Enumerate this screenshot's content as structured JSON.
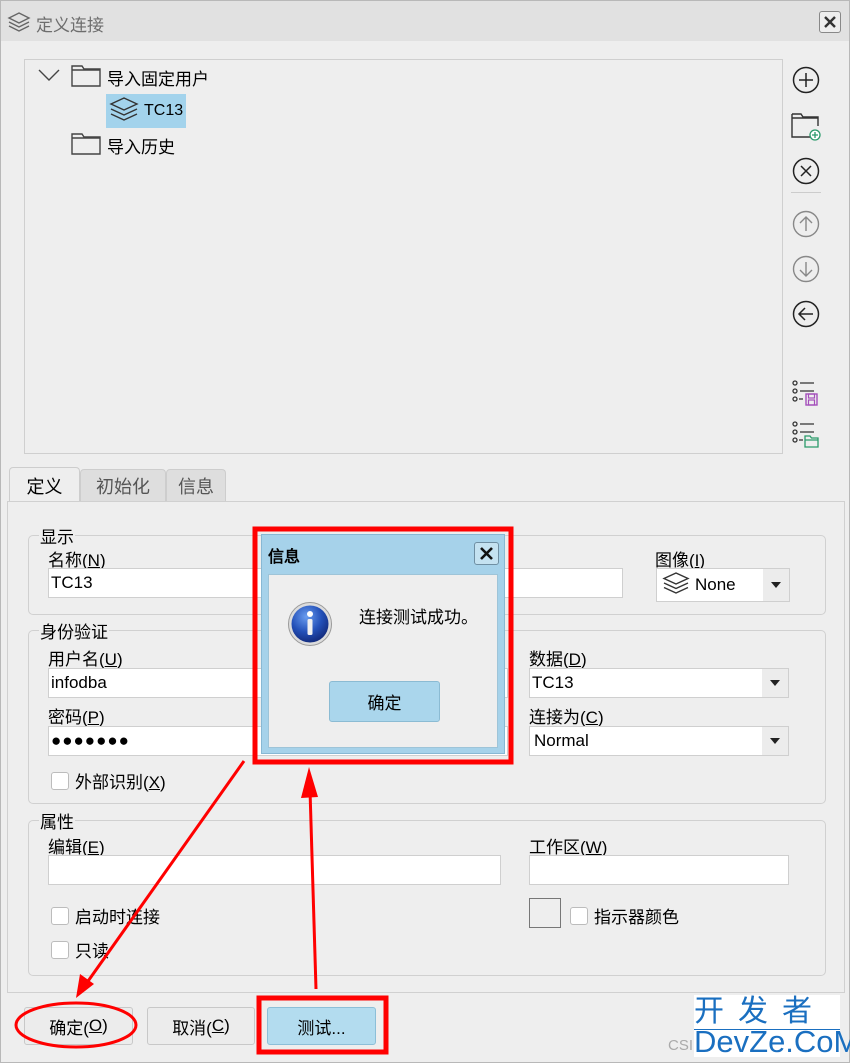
{
  "window": {
    "title": "定义连接",
    "icon": "layers-icon",
    "close_icon": "close-icon"
  },
  "tree": {
    "items": [
      {
        "label": "导入固定用户",
        "icon": "folder-icon",
        "expanded": true,
        "level": 0
      },
      {
        "label": "TC13",
        "icon": "layers-icon",
        "selected": true,
        "level": 1
      },
      {
        "label": "导入历史",
        "icon": "folder-icon",
        "level": 0
      }
    ]
  },
  "side_toolbar": [
    {
      "name": "add",
      "icon": "plus-circle-icon",
      "enabled": true
    },
    {
      "name": "new-folder",
      "icon": "folder-add-icon",
      "enabled": true
    },
    {
      "name": "delete",
      "icon": "x-circle-icon",
      "enabled": true
    },
    {
      "name": "move-up",
      "icon": "arrow-up-circle-icon",
      "enabled": false
    },
    {
      "name": "move-down",
      "icon": "arrow-down-circle-icon",
      "enabled": false
    },
    {
      "name": "move-left",
      "icon": "arrow-left-circle-icon",
      "enabled": true
    },
    {
      "name": "save-list",
      "icon": "list-save-icon",
      "enabled": true
    },
    {
      "name": "open-list",
      "icon": "list-folder-icon",
      "enabled": true
    }
  ],
  "tabs": [
    {
      "label": "定义",
      "active": true
    },
    {
      "label": "初始化",
      "active": false
    },
    {
      "label": "信息",
      "active": false
    }
  ],
  "display_group": {
    "title": "显示",
    "name_label": "名称(",
    "name_key": "N",
    "name_value": "TC13",
    "image_label": "图像(",
    "image_key": "I",
    "image_value": "None"
  },
  "auth_group": {
    "title": "身份验证",
    "user_label": "用户名(",
    "user_key": "U",
    "user_value": "infodba",
    "password_label": "密码(",
    "password_key": "P",
    "password_value": "●●●●●●●",
    "external_label": "外部识别(",
    "external_key": "X",
    "external_checked": false,
    "data_label": "数据(",
    "data_key": "D",
    "data_value": "TC13",
    "connect_as_label": "连接为(",
    "connect_as_key": "C",
    "connect_as_value": "Normal"
  },
  "props_group": {
    "title": "属性",
    "edit_label": "编辑(",
    "edit_key": "E",
    "edit_value": "",
    "workspace_label": "工作区(",
    "workspace_key": "W",
    "workspace_value": "",
    "connect_on_start_label": "启动时连接",
    "connect_on_start_checked": false,
    "readonly_label": "只读",
    "readonly_checked": false,
    "indicator_color_label": "指示器颜色",
    "indicator_color_checked": false
  },
  "buttons": {
    "ok_label": "确定(",
    "ok_key": "O",
    "cancel_label": "取消(",
    "cancel_key": "C",
    "test_label": "测试..."
  },
  "message_dialog": {
    "title": "信息",
    "icon": "info-icon",
    "message": "连接测试成功。",
    "ok_label": "确定"
  },
  "annotations": {
    "highlight_color": "#ff0000"
  },
  "watermark": {
    "line1": "开发者",
    "line2": "DevZe.CoM",
    "prefix": "CSI"
  }
}
